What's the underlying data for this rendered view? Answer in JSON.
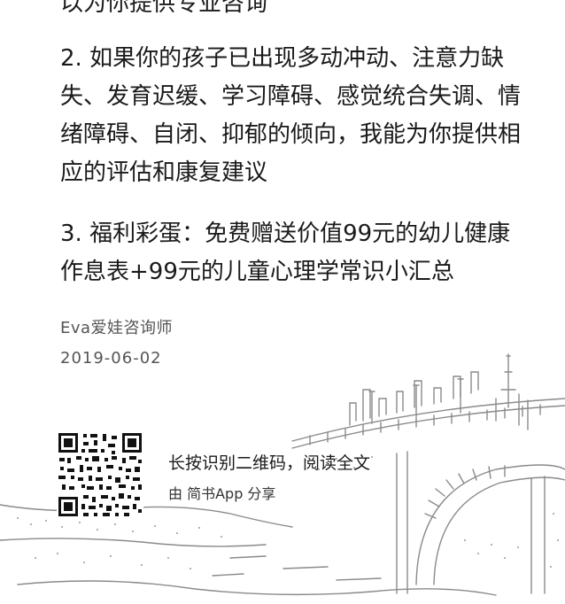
{
  "article": {
    "cut_line": "以为你提供专业咨询",
    "item2": "2. 如果你的孩子已出现多动冲动、注意力缺失、发育迟缓、学习障碍、感觉统合失调、情绪障碍、自闭、抑郁的倾向，我能为你提供相应的评估和康复建议",
    "item3": "3. 福利彩蛋：免费赠送价值99元的幼儿健康作息表+99元的儿童心理学常识小汇总",
    "author": "Eva爱娃咨询师",
    "date": "2019-06-02"
  },
  "share": {
    "title": "长按识别二维码，阅读全文",
    "subtitle": "由 简书App 分享",
    "qr_icon": "qr-code-icon"
  },
  "colors": {
    "text": "#1a1a1a",
    "meta": "#555555",
    "sketch": "#8a8a8a"
  }
}
